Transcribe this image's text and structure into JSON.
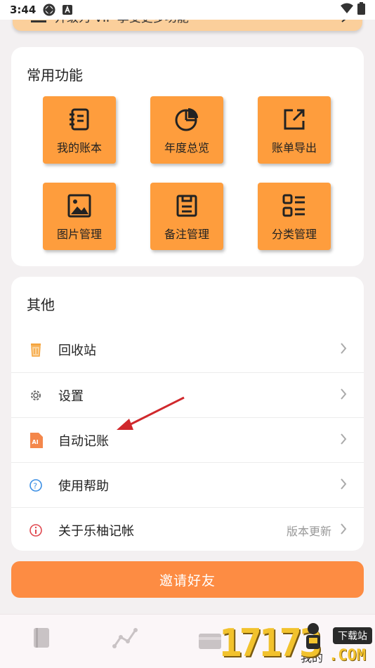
{
  "status_bar": {
    "time": "3:44"
  },
  "vip_banner": {
    "text": "开级为 VIP 享受更多功能"
  },
  "common": {
    "title": "常用功能",
    "tiles": [
      {
        "label": "我的账本",
        "icon": "notebook-icon"
      },
      {
        "label": "年度总览",
        "icon": "pie-chart-icon"
      },
      {
        "label": "账单导出",
        "icon": "export-icon"
      },
      {
        "label": "图片管理",
        "icon": "image-icon"
      },
      {
        "label": "备注管理",
        "icon": "note-icon"
      },
      {
        "label": "分类管理",
        "icon": "category-list-icon"
      }
    ]
  },
  "other": {
    "title": "其他",
    "items": [
      {
        "label": "回收站",
        "icon": "trash-icon",
        "extra": ""
      },
      {
        "label": "设置",
        "icon": "gear-icon",
        "extra": ""
      },
      {
        "label": "自动记账",
        "icon": "ai-icon",
        "extra": ""
      },
      {
        "label": "使用帮助",
        "icon": "help-icon",
        "extra": ""
      },
      {
        "label": "关于乐柚记帐",
        "icon": "info-icon",
        "extra": "版本更新"
      }
    ]
  },
  "invite_button": "邀请好友",
  "tabbar": {
    "tabs": [
      {
        "icon": "book-icon"
      },
      {
        "icon": "trend-icon"
      },
      {
        "icon": "card-icon"
      },
      {
        "icon": "person-icon",
        "label": "我的"
      }
    ]
  },
  "watermark": {
    "number": "17173",
    "box": "下载站",
    "domain": ".COM"
  },
  "colors": {
    "accent": "#fd8c43",
    "tile": "#fe9d3d",
    "banner": "#fbcf9b"
  }
}
